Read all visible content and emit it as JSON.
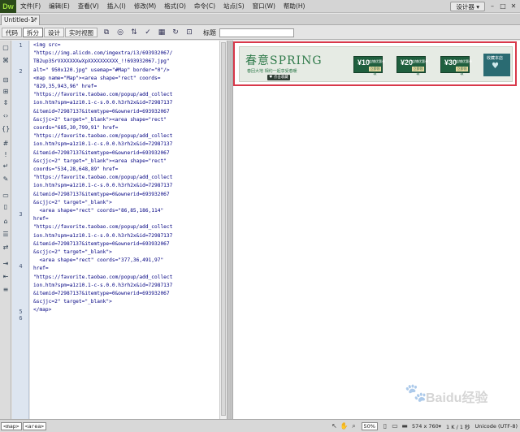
{
  "app": {
    "logo": "Dw",
    "menu": [
      "文件(F)",
      "编辑(E)",
      "查看(V)",
      "插入(I)",
      "修改(M)",
      "格式(O)",
      "命令(C)",
      "站点(S)",
      "窗口(W)",
      "帮助(H)"
    ],
    "designer_label": "设计器 ▾"
  },
  "document_tab": {
    "label": "Untitled-1*",
    "close": "×"
  },
  "toolbar": {
    "buttons": [
      "代码",
      "拆分",
      "设计",
      "实时视图"
    ],
    "active": "拆分",
    "title_label": "标题",
    "title_value": ""
  },
  "code": {
    "line_numbers": [
      "1",
      "2",
      "3",
      "4",
      "5",
      "6"
    ],
    "lines": [
      "<img src=",
      "\"https://img.alicdn.com/imgextra/i3/693932067/",
      "TB2up3SrVXXXXXXwXpXXXXXXXXXX_!!693932067.jpg\"",
      "alt=\" 950x120.jpg\" usemap=\"#Map\" border=\"0\"/>",
      "<map name=\"Map\"><area shape=\"rect\" coords=",
      "\"829,35,943,96\" href=",
      "\"https://favorite.taobao.com/popup/add_collect",
      "ion.htm?spm=a1z10.1-c-s.0.0.h3rh2x&id=72987137",
      "&itemid=72987137&itemtype=0&ownerid=693932067",
      "&scjjc=2\" target=\"_blank\"><area shape=\"rect\"",
      "coords=\"685,30,799,91\" href=",
      "\"https://favorite.taobao.com/popup/add_collect",
      "ion.htm?spm=a1z10.1-c-s.0.0.h3rh2x&id=72987137",
      "&itemid=72987137&itemtype=0&ownerid=693932067",
      "&scjjc=2\" target=\"_blank\"><area shape=\"rect\"",
      "coords=\"534,28,648,89\" href=",
      "\"https://favorite.taobao.com/popup/add_collect",
      "ion.htm?spm=a1z10.1-c-s.0.0.h3rh2x&id=72987137",
      "&itemid=72987137&itemtype=0&ownerid=693932067",
      "&scjjc=2\" target=\"_blank\">",
      "  <area shape=\"rect\" coords=\"86,85,186,114\"",
      "href=",
      "\"https://favorite.taobao.com/popup/add_collect",
      "ion.htm?spm=a1z10.1-c-s.0.0.h3rh2x&id=72987137",
      "&itemid=72987137&itemtype=0&ownerid=693932067",
      "&scjjc=2\" target=\"_blank\">",
      "  <area shape=\"rect\" coords=\"377,36,491,97\"",
      "href=",
      "\"https://favorite.taobao.com/popup/add_collect",
      "ion.htm?spm=a1z10.1-c-s.0.0.h3rh2x&id=72987137",
      "&itemid=72987137&itemtype=0&ownerid=693932067",
      "&scjjc=2\" target=\"_blank\">",
      "</map>"
    ]
  },
  "banner": {
    "title": "春意SPRING",
    "subtitle": "春回大地  相约一起享受春暖",
    "tag": "♥ 点击收藏",
    "coupons": [
      {
        "amount": "¥10",
        "desc": "店铺优惠券",
        "get": "立即领取"
      },
      {
        "amount": "¥20",
        "desc": "店铺优惠券",
        "get": "立即领取"
      },
      {
        "amount": "¥30",
        "desc": "店铺优惠券",
        "get": "立即领取"
      }
    ],
    "favorite": "收藏本店"
  },
  "status": {
    "tags": [
      "<map>",
      "<area>"
    ],
    "zoom": "50%",
    "dimensions": "574 x 760▾",
    "size": "1 K / 1 秒",
    "encoding": "Unicode (UTF-8)"
  },
  "watermark": {
    "text": "Baidu经验"
  },
  "colors": {
    "selection_border": "#d8384a",
    "coupon_bg": "#1f5f3e",
    "gutter_bg": "#dde5f0"
  }
}
